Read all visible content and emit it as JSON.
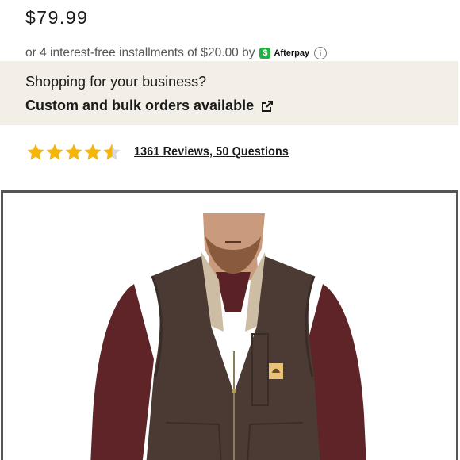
{
  "product": {
    "price": "$79.99",
    "installments_text": "or 4 interest-free installments of $20.00 by",
    "afterpay_label": "Afterpay",
    "afterpay_badge": "$",
    "info_glyph": "i"
  },
  "business_banner": {
    "heading": "Shopping for your business?",
    "link_label": "Custom and bulk orders available"
  },
  "reviews": {
    "rating": 4.5,
    "max_rating": 5,
    "link_label": "1361 Reviews, 50 Questions"
  },
  "colors": {
    "banner_bg": "#f3eee6",
    "star": "#f5b50a",
    "afterpay": "#1fb141",
    "vest": "#4a3a33",
    "shirt": "#5e2428"
  },
  "icons": {
    "afterpay": "afterpay-logo-icon",
    "info": "info-icon",
    "external_link": "external-link-icon",
    "star": "star-icon"
  },
  "product_image": {
    "subject": "man-wearing-brown-sherpa-lined-vest",
    "patch_logo": "Carhartt"
  }
}
